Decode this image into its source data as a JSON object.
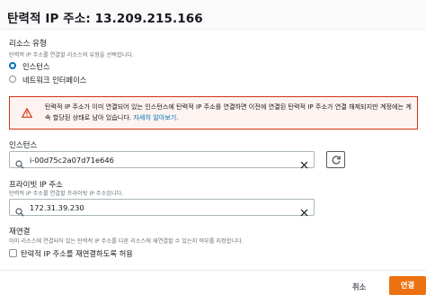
{
  "dialog": {
    "title": "탄력적 IP 주소: 13.209.215.166"
  },
  "resource_type": {
    "label": "리소스 유형",
    "description": "탄력적 IP 주소를 연결할 리소스의 유형을 선택합니다.",
    "options": [
      {
        "label": "인스턴스",
        "checked": true
      },
      {
        "label": "네트워크 인터페이스",
        "checked": false
      }
    ]
  },
  "alert": {
    "text": "탄력적 IP 주소가 이미 연결되어 있는 인스턴스에 탄력적 IP 주소를 연결하면 이전에 연결된 탄력적 IP 주소가 연결 해제되지만 계정에는 계속 할당된 상태로 남아 있습니다.",
    "link_label": "자세히 알아보기.",
    "icon": "warning-icon",
    "color": "#d13212"
  },
  "instance": {
    "label": "인스턴스",
    "value": "i-00d75c2a07d71e646",
    "search_icon": "search-icon",
    "clear_icon": "close-icon",
    "refresh_icon": "refresh-icon"
  },
  "private_ip": {
    "label": "프라이빗 IP 주소",
    "description": "탄력적 IP 주소를 연결할 프라이빗 IP 주소입니다.",
    "value": "172.31.39.230"
  },
  "reassociation": {
    "label": "재연결",
    "description": "이미 리소스에 연결되어 있는 탄력적 IP 주소를 다른 리소스에 재연결할 수 있는지 여부를 지정합니다.",
    "checkbox_label": "탄력적 IP 주소를 재연결하도록 허용",
    "checked": false
  },
  "footer": {
    "cancel_label": "취소",
    "primary_label": "연결",
    "primary_color": "#ec7211"
  }
}
